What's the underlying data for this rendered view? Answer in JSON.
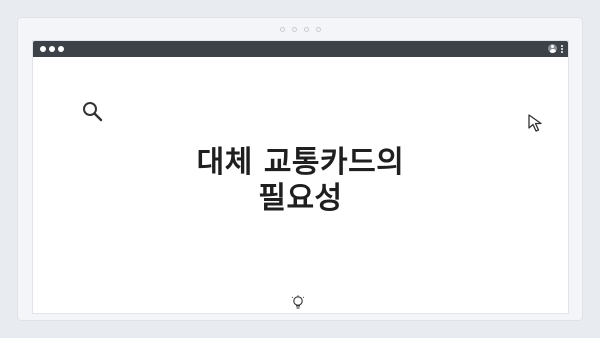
{
  "window": {
    "controls": [
      "dot",
      "dot",
      "dot"
    ],
    "right_icons": [
      "user-avatar-icon",
      "more-vertical-icon"
    ]
  },
  "page": {
    "headline_line1": "대체 교통카드의",
    "headline_line2": "필요성"
  },
  "icons": {
    "search": "search-icon",
    "cursor": "cursor-arrow-icon",
    "bulb": "lightbulb-icon"
  },
  "colors": {
    "background": "#e8ebf0",
    "titlebar": "#3d4148",
    "headline": "#1f1f1f"
  }
}
